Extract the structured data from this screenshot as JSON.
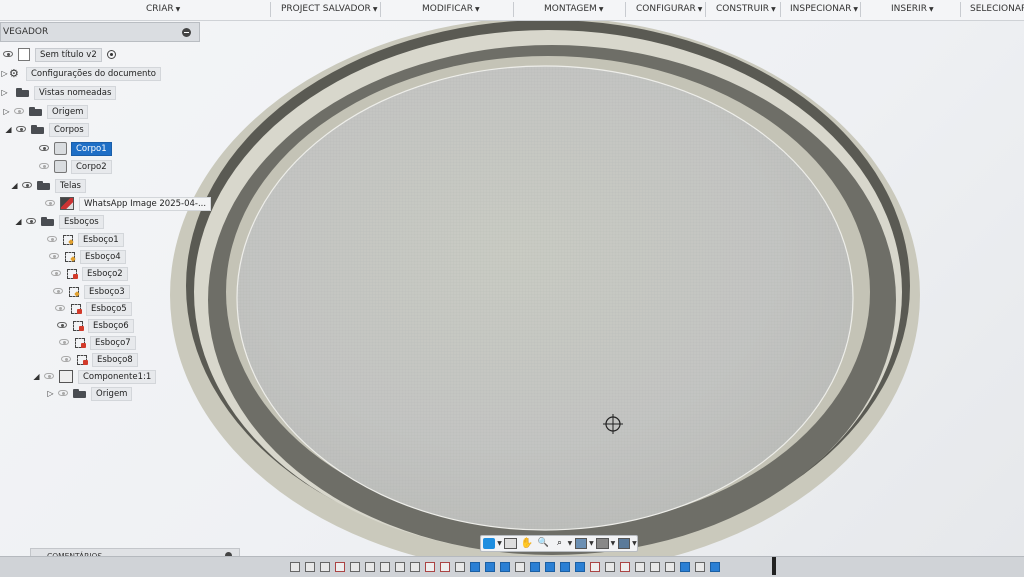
{
  "toolbar": {
    "menus": [
      "CRIAR",
      "PROJECT SALVADOR",
      "MODIFICAR",
      "MONTAGEM",
      "CONFIGURAR",
      "CONSTRUIR",
      "INSPECIONAR",
      "INSERIR",
      "SELECIONAR"
    ]
  },
  "browser": {
    "title": "VEGADOR",
    "document": "Sem título v2",
    "doc_settings": "Configurações do documento",
    "named_views": "Vistas nomeadas",
    "origin": "Origem",
    "bodies": "Corpos",
    "body1": "Corpo1",
    "body2": "Corpo2",
    "canvases": "Telas",
    "canvas1": "WhatsApp Image 2025-04-...",
    "sketches": "Esboços",
    "sketch_items": [
      "Esboço1",
      "Esboço4",
      "Esboço2",
      "Esboço3",
      "Esboço5",
      "Esboço6",
      "Esboço7",
      "Esboço8"
    ],
    "component": "Componente1:1",
    "component_origin": "Origem"
  },
  "comments": {
    "label": "COMENTÁRIOS"
  },
  "colors": {
    "selection": "#1f6fc6",
    "accent_blue": "#1e8ee0",
    "model_body": "#c9c8bb",
    "model_face": "#c4c5c4",
    "model_wall": "#5d5d56"
  },
  "icons": [
    "eye-icon",
    "folder-icon",
    "gear-icon",
    "body-icon",
    "sketch-icon",
    "canvas-icon",
    "component-icon",
    "orbit-icon",
    "pan-icon",
    "zoom-icon",
    "display-settings-icon",
    "grid-icon",
    "viewports-icon"
  ]
}
